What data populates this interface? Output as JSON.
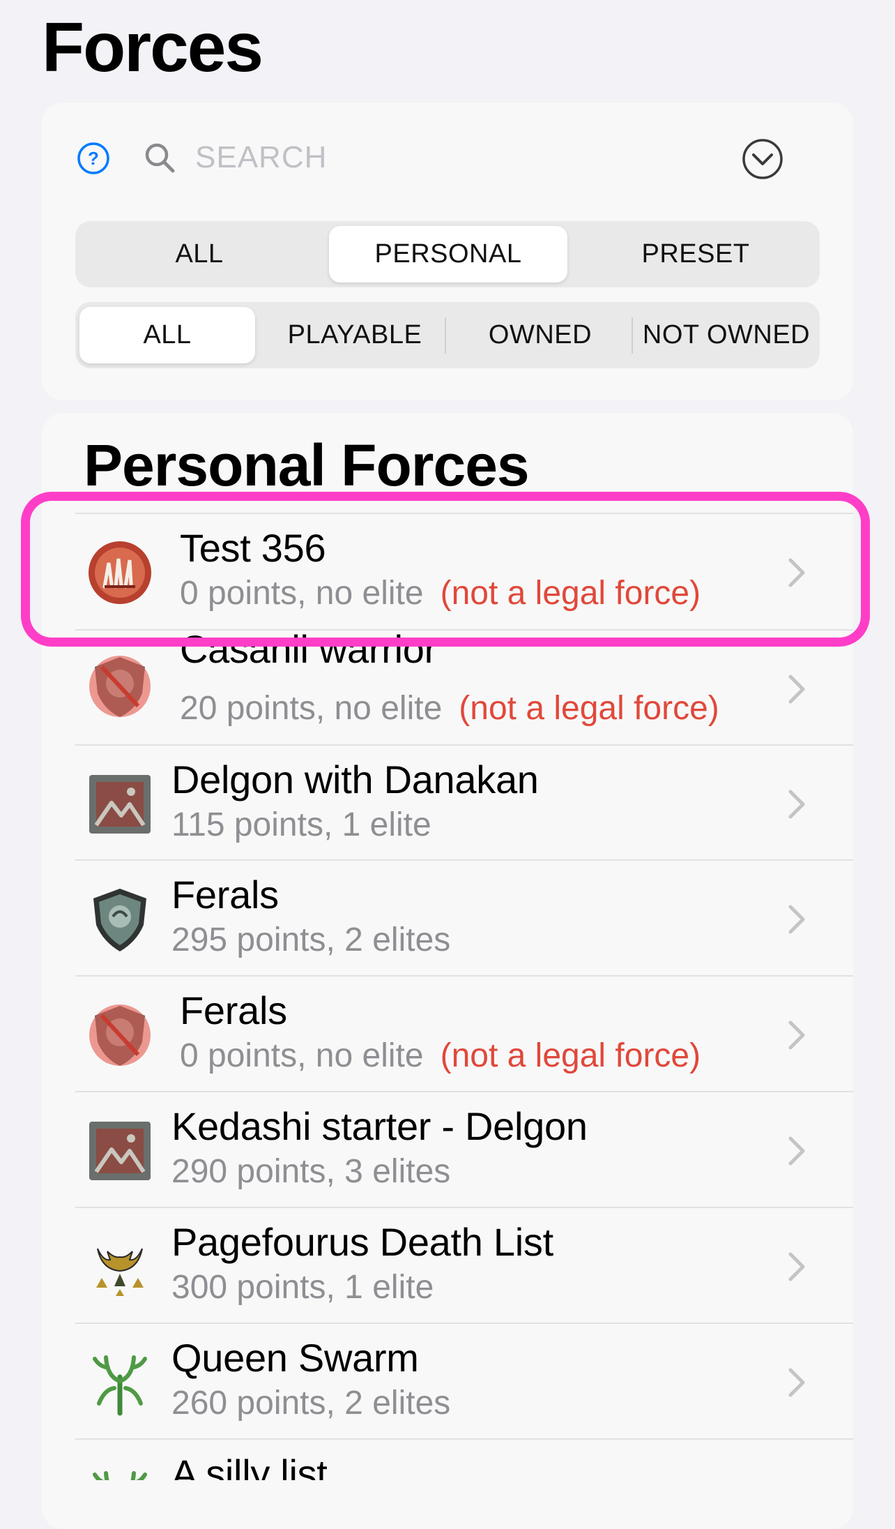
{
  "header": {
    "title": "Forces"
  },
  "search": {
    "placeholder": "SEARCH",
    "value": ""
  },
  "source_filter": {
    "options": [
      "ALL",
      "PERSONAL",
      "PRESET"
    ],
    "selected": "PERSONAL"
  },
  "ownership_filter": {
    "options": [
      "ALL",
      "PLAYABLE",
      "OWNED",
      "NOT OWNED"
    ],
    "selected": "ALL"
  },
  "section": {
    "title": "Personal Forces"
  },
  "forces": [
    {
      "name": "Test 356",
      "summary": "0 points, no elite",
      "status": "(not a legal force)",
      "icon": "red-claw-emblem-icon",
      "highlighted": true
    },
    {
      "name": "Casanii warrior",
      "summary": "20 points, no elite",
      "status": "(not a legal force)",
      "icon": "crossed-out-shield-icon"
    },
    {
      "name": "Delgon with Danakan",
      "summary": "115 points, 1 elite",
      "status": "",
      "icon": "stone-tablet-icon"
    },
    {
      "name": "Ferals",
      "summary": "295 points, 2 elites",
      "status": "",
      "icon": "shield-icon"
    },
    {
      "name": "Ferals",
      "summary": "0 points, no elite",
      "status": "(not a legal force)",
      "icon": "crossed-out-shield-icon"
    },
    {
      "name": "Kedashi starter - Delgon",
      "summary": "290 points, 3 elites",
      "status": "",
      "icon": "stone-tablet-icon"
    },
    {
      "name": "Pagefourus Death List",
      "summary": "300 points, 1 elite",
      "status": "",
      "icon": "gold-horns-emblem-icon"
    },
    {
      "name": "Queen Swarm",
      "summary": "260 points, 2 elites",
      "status": "",
      "icon": "green-antlers-emblem-icon"
    },
    {
      "name": "A silly list",
      "summary": "",
      "status": "",
      "icon": "green-antlers-emblem-icon"
    }
  ],
  "colors": {
    "accent": "#007aff",
    "warning": "#e0483a",
    "highlight": "#ff3ec8",
    "secondary_text": "#8e8e93"
  }
}
